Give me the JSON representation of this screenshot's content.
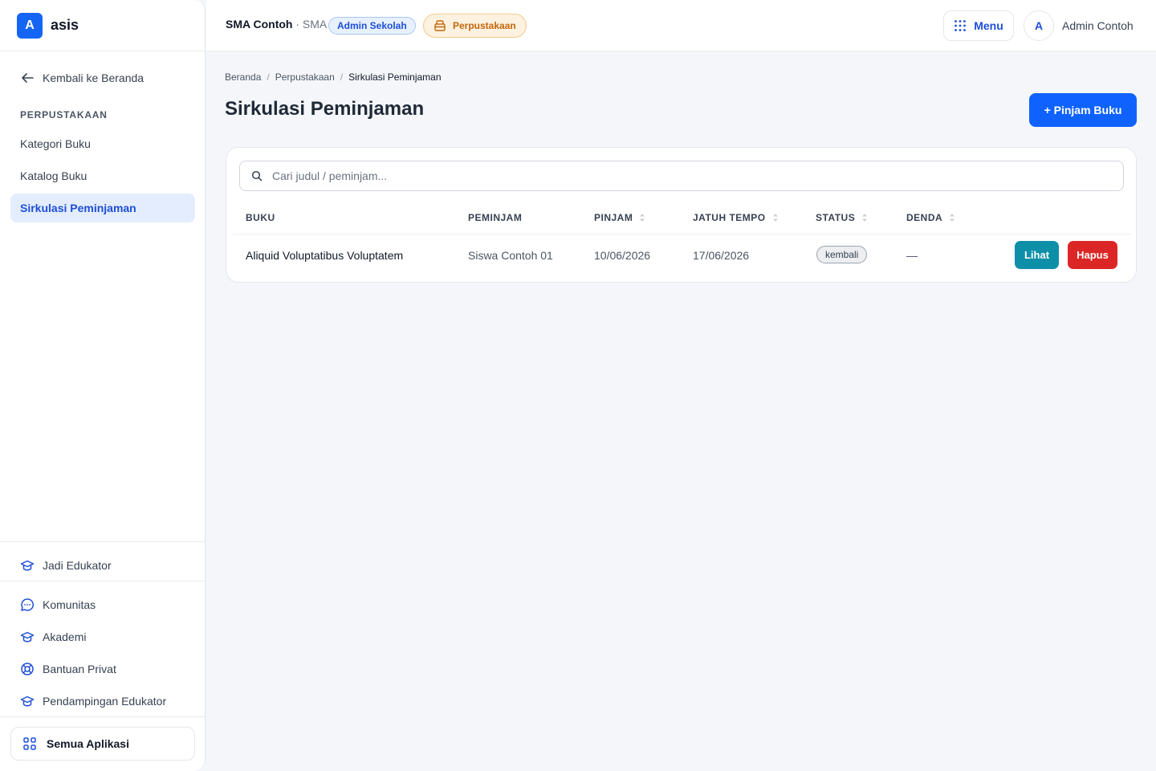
{
  "brand": {
    "logo_letter": "A",
    "name": "asis"
  },
  "sidebar": {
    "back_label": "Kembali ke Beranda",
    "section_label": "PERPUSTAKAAN",
    "items": [
      {
        "label": "Kategori Buku"
      },
      {
        "label": "Katalog Buku"
      },
      {
        "label": "Sirkulasi Peminjaman",
        "active": true
      }
    ],
    "educator_label": "Jadi Edukator",
    "links": [
      {
        "label": "Komunitas",
        "icon": "chat-icon"
      },
      {
        "label": "Akademi",
        "icon": "graduation-cap-icon"
      },
      {
        "label": "Bantuan Privat",
        "icon": "lifebuoy-icon"
      },
      {
        "label": "Pendampingan Edukator",
        "icon": "graduation-cap-icon"
      }
    ],
    "all_apps_label": "Semua Aplikasi"
  },
  "topbar": {
    "school_name": "SMA Contoh",
    "school_type": " · SMA",
    "role_badge": "Admin Sekolah",
    "module_badge": "Perpustakaan",
    "menu_label": "Menu",
    "avatar_letter": "A",
    "user_name": "Admin Contoh"
  },
  "breadcrumb": [
    "Beranda",
    "Perpustakaan",
    "Sirkulasi Peminjaman"
  ],
  "page": {
    "title": "Sirkulasi Peminjaman",
    "primary_action": "+ Pinjam Buku"
  },
  "search": {
    "placeholder": "Cari judul / peminjam..."
  },
  "table": {
    "columns": [
      "BUKU",
      "PEMINJAM",
      "PINJAM",
      "JATUH TEMPO",
      "STATUS",
      "DENDA"
    ],
    "rows": [
      {
        "book": "Aliquid Voluptatibus Voluptatem",
        "borrower": "Siswa Contoh 01",
        "borrowed": "10/06/2026",
        "due": "17/06/2026",
        "status": "kembali",
        "fine": "—",
        "view_label": "Lihat",
        "delete_label": "Hapus"
      }
    ]
  },
  "colors": {
    "primary": "#0f62fe",
    "view_button": "#0e8fa8",
    "delete_button": "#dc2626",
    "library_badge": "#c2680a"
  }
}
